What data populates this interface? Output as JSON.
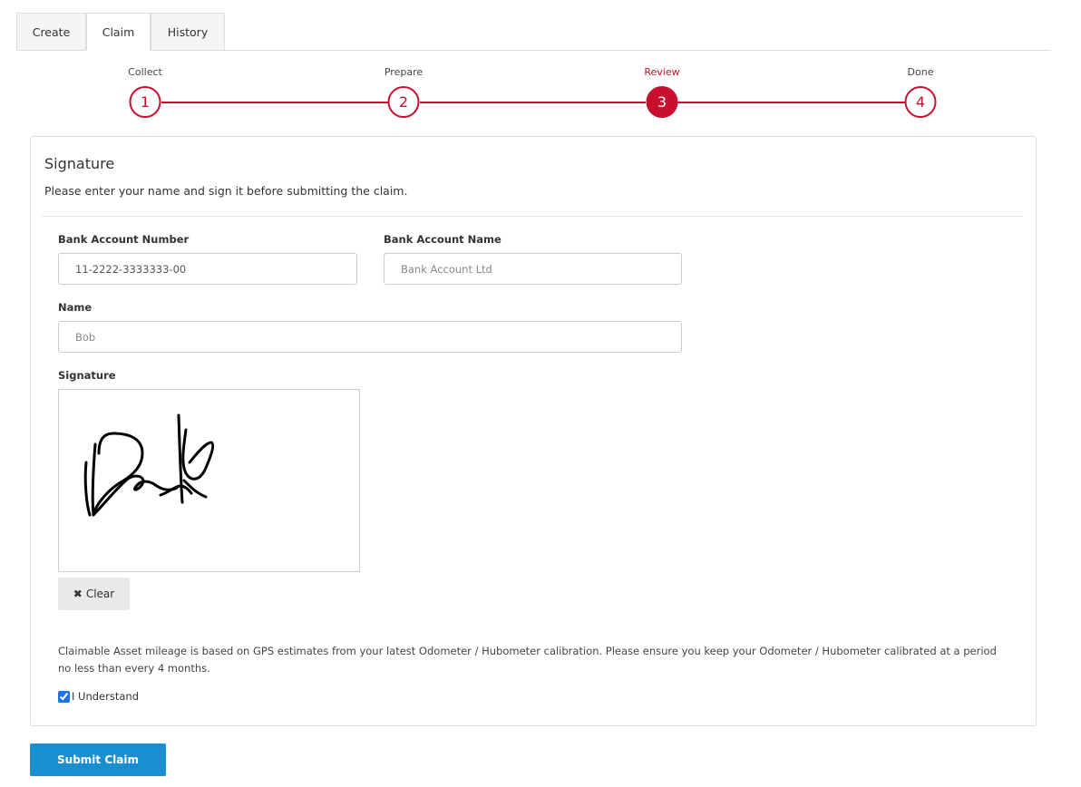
{
  "tabs": [
    {
      "label": "Create",
      "active": false
    },
    {
      "label": "Claim",
      "active": true
    },
    {
      "label": "History",
      "active": false
    }
  ],
  "stepper": {
    "steps": [
      {
        "label": "Collect",
        "number": "1"
      },
      {
        "label": "Prepare",
        "number": "2"
      },
      {
        "label": "Review",
        "number": "3"
      },
      {
        "label": "Done",
        "number": "4"
      }
    ],
    "current_step": 3
  },
  "signature_panel": {
    "title": "Signature",
    "description": "Please enter your name and sign it before submitting the claim."
  },
  "form": {
    "bank_account_number": {
      "label": "Bank Account Number",
      "value": "11-2222-3333333-00"
    },
    "bank_account_name": {
      "label": "Bank Account Name",
      "placeholder": "Bank Account Ltd"
    },
    "name": {
      "label": "Name",
      "placeholder": "Bob"
    },
    "signature": {
      "label": "Signature"
    },
    "clear_label": "Clear"
  },
  "notice": "Claimable Asset mileage is based on GPS estimates from your latest Odometer / Hubometer calibration. Please ensure you keep your Odometer / Hubometer calibrated at a period no less than every 4 months.",
  "acknowledge": {
    "label": "I Understand",
    "checked": true
  },
  "submit_label": "Submit Claim",
  "colors": {
    "accent": "#c8102e",
    "primary_button": "#1a8fd0"
  },
  "icons": {
    "clear": "times-icon"
  }
}
